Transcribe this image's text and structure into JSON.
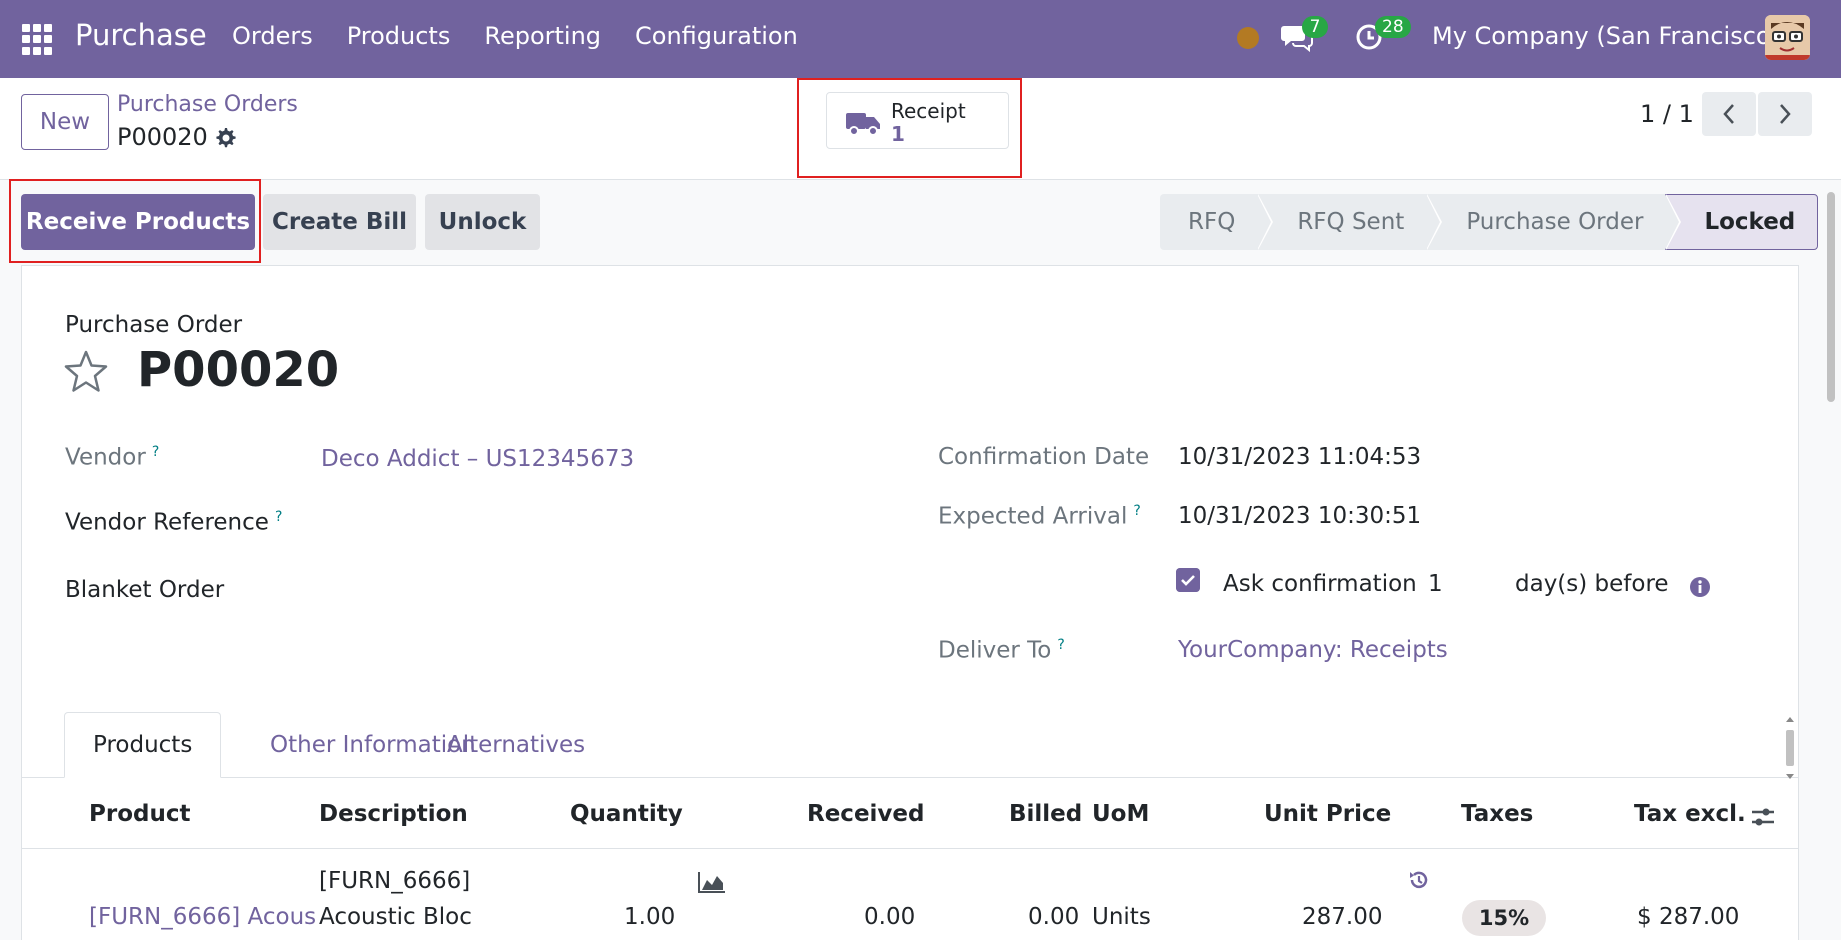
{
  "navbar": {
    "app_name": "Purchase",
    "menu": [
      "Orders",
      "Products",
      "Reporting",
      "Configuration"
    ],
    "chat_count": "7",
    "activity_count": "28",
    "company": "My Company (San Francisco)"
  },
  "control_panel": {
    "new_label": "New",
    "breadcrumb_parent": "Purchase Orders",
    "breadcrumb_current": "P00020",
    "smart_button": {
      "label": "Receipt",
      "value": "1"
    },
    "pager": "1 / 1"
  },
  "actions": {
    "primary": "Receive Products",
    "create_bill": "Create Bill",
    "unlock": "Unlock"
  },
  "statusbar": {
    "stages": [
      "RFQ",
      "RFQ Sent",
      "Purchase Order",
      "Locked"
    ],
    "active": "Locked"
  },
  "form": {
    "doc_label": "Purchase Order",
    "doc_name": "P00020",
    "vendor_label": "Vendor",
    "vendor_value": "Deco Addict – US12345673",
    "vendor_ref_label": "Vendor Reference",
    "blanket_label": "Blanket Order",
    "confirmation_label": "Confirmation Date",
    "confirmation_value": "10/31/2023 11:04:53",
    "expected_label": "Expected Arrival",
    "expected_value": "10/31/2023 10:30:51",
    "ask_label": "Ask confirmation",
    "ask_days": "1",
    "ask_suffix": "day(s) before",
    "deliver_label": "Deliver To",
    "deliver_value": "YourCompany: Receipts",
    "help_mark": "?"
  },
  "tabs": [
    "Products",
    "Other Information",
    "Alternatives"
  ],
  "table": {
    "headers": [
      "Product",
      "Description",
      "Quantity",
      "Received",
      "Billed",
      "UoM",
      "Unit Price",
      "Taxes",
      "Tax excl."
    ],
    "rows": [
      {
        "product": "[FURN_6666] Acous",
        "description_line1": "[FURN_6666]",
        "description_line2": "Acoustic Bloc",
        "quantity": "1.00",
        "received": "0.00",
        "billed": "0.00",
        "uom": "Units",
        "unit_price": "287.00",
        "taxes": "15%",
        "tax_excl": "$ 287.00"
      }
    ]
  },
  "colors": {
    "brand": "#71639e",
    "highlight": "#e02020",
    "badge": "#28a745"
  }
}
